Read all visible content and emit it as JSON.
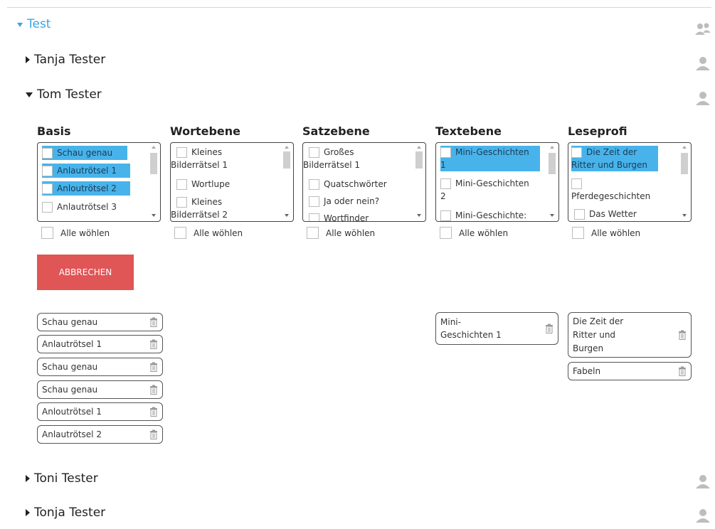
{
  "group": {
    "name": "Test",
    "icon": "group-users-icon"
  },
  "people": [
    {
      "name": "Tanja Tester",
      "expanded": false,
      "icon": "user-icon"
    },
    {
      "name": "Tom Tester",
      "expanded": true,
      "icon": "user-icon"
    },
    {
      "name": "Toni Tester",
      "expanded": false,
      "icon": "user-icon"
    },
    {
      "name": "Tonja Tester",
      "expanded": false,
      "icon": "user-icon"
    }
  ],
  "categories": [
    {
      "title": "Basis",
      "options": [
        {
          "label": "Schau genau",
          "selected": true
        },
        {
          "label": "Anlautrötsel 1",
          "selected": true
        },
        {
          "label": "Anloutrötsel 2",
          "selected": true
        },
        {
          "label": "Anlautrötsel 3",
          "selected": false
        }
      ],
      "select_all": "Alle wöhlen"
    },
    {
      "title": "Wortebene",
      "options": [
        {
          "label_line1": "Kleines",
          "label_line2": "Bilderrätsel 1",
          "selected": false
        },
        {
          "label": "Wortlupe",
          "selected": false
        },
        {
          "label_line1": "Kleines",
          "label_line2": "Bilderrätsel 2",
          "selected": false
        }
      ],
      "select_all": "Alle wöhlen"
    },
    {
      "title": "Satzebene",
      "options": [
        {
          "label_line1": "Großes",
          "label_line2": "Bilderrätsel 1",
          "selected": false
        },
        {
          "label": "Quatschwörter",
          "selected": false
        },
        {
          "label": "Ja oder nein?",
          "selected": false
        },
        {
          "label": "Wortfinder",
          "selected": false
        }
      ],
      "select_all": "Alle wöhlen"
    },
    {
      "title": "Textebene",
      "options": [
        {
          "label_line1": "Mini-Geschichten",
          "label_line2": "1",
          "selected": true
        },
        {
          "label_line1": "Mini-Geschichten",
          "label_line2": "2",
          "selected": false
        },
        {
          "label": "Mini-Geschichte:",
          "selected": false
        }
      ],
      "select_all": "Alle wöhlen"
    },
    {
      "title": "Leseprofi",
      "options": [
        {
          "label_line1": "Die Zeit der",
          "label_line2": "Ritter und Burgen",
          "selected": true
        },
        {
          "label": "Pferdegeschichten",
          "selected": false
        },
        {
          "label": "Das Wetter",
          "selected": false
        }
      ],
      "select_all": "Alle wöhlen"
    }
  ],
  "cancel_label": "ABBRECHEN",
  "chips": {
    "basis": [
      "Schau genau",
      "Anlautrötsel 1",
      "Schau genau",
      "Schau genau",
      "Anloutrötsel 1",
      "Anlautrötsel 2"
    ],
    "textebene": [
      {
        "line1": "Mini-",
        "line2": "Geschichten 1"
      }
    ],
    "leseprofi": [
      {
        "line1": "Die Zeit der",
        "line2": "Ritter und",
        "line3": "Burgen"
      },
      {
        "line1": "Fabeln"
      }
    ]
  },
  "colors": {
    "accent": "#3aa6e0",
    "selection": "#48b3ea",
    "cancel": "#e05555",
    "icon": "#bdbdbd"
  }
}
